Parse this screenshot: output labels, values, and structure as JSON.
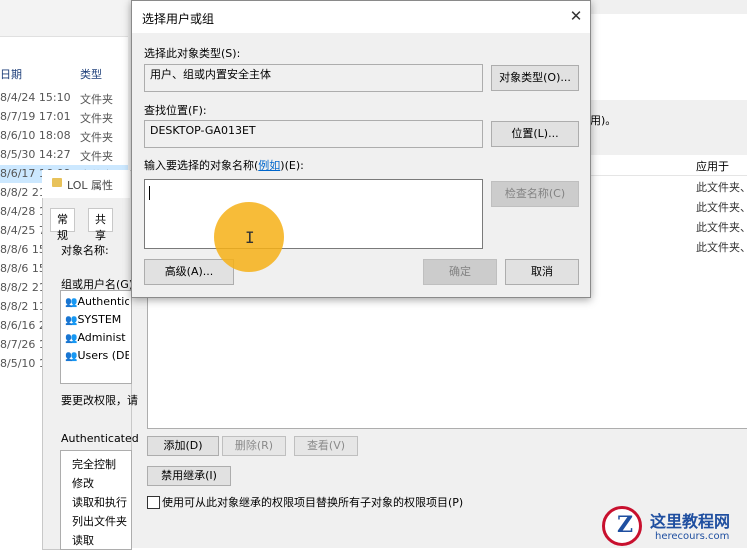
{
  "explorer": {
    "col_date": "日期",
    "col_type": "类型",
    "rows": [
      {
        "date": "8/4/24 15:10",
        "type": "文件夹"
      },
      {
        "date": "8/7/19 17:01",
        "type": "文件夹"
      },
      {
        "date": "8/6/10 18:08",
        "type": "文件夹"
      },
      {
        "date": "8/5/30 14:27",
        "type": "文件夹"
      },
      {
        "date": "8/6/17 16:09",
        "type": "文件夹"
      },
      {
        "date": "8/8/2 21:",
        "type": ""
      },
      {
        "date": "8/4/28 1",
        "type": ""
      },
      {
        "date": "8/4/25 7:",
        "type": ""
      },
      {
        "date": "8/8/6 15:",
        "type": ""
      },
      {
        "date": "8/8/6 15:",
        "type": ""
      },
      {
        "date": "8/8/2 21:",
        "type": ""
      },
      {
        "date": "8/8/2 11:",
        "type": ""
      },
      {
        "date": "8/6/16 20",
        "type": ""
      },
      {
        "date": "8/7/26 10",
        "type": ""
      },
      {
        "date": "8/5/10 15",
        "type": ""
      }
    ]
  },
  "properties": {
    "title": "LOL 属性",
    "tabs": [
      "常规",
      "共享"
    ],
    "object_name_label": "对象名称:",
    "group_label": "组或用户名(G):",
    "users": [
      "Authentic",
      "SYSTEM",
      "Administ",
      "Users (DE"
    ],
    "change_perm_text": "要更改权限，请",
    "perm_for": "Authenticated",
    "permissions": [
      "完全控制",
      "修改",
      "读取和执行",
      "列出文件夹",
      "读取"
    ]
  },
  "advanced": {
    "header_fragment": "用)。",
    "col_applies": "应用于",
    "applies_rows": [
      "此文件夹、",
      "此文件夹、",
      "此文件夹、",
      "此文件夹、"
    ],
    "btn_add": "添加(D)",
    "btn_remove": "删除(R)",
    "btn_view": "查看(V)",
    "btn_disable_inherit": "禁用继承(I)",
    "replace_checkbox": "使用可从此对象继承的权限项目替换所有子对象的权限项目(P)"
  },
  "dialog": {
    "title": "选择用户或组",
    "close_glyph": "✕",
    "object_type_label": "选择此对象类型(S):",
    "object_type_value": "用户、组或内置安全主体",
    "object_type_button": "对象类型(O)...",
    "location_label": "查找位置(F):",
    "location_value": "DESKTOP-GA013ET",
    "location_button": "位置(L)...",
    "enter_names_prefix": "输入要选择的对象名称(",
    "enter_names_link": "例如",
    "enter_names_suffix": ")(E):",
    "enter_names_value": "",
    "check_names_button": "检查名称(C)",
    "advanced_button": "高级(A)...",
    "ok_button": "确定",
    "cancel_button": "取消"
  },
  "watermark": {
    "letter": "Z",
    "title": "这里教程网",
    "url": "herecours.com"
  },
  "colors": {
    "accent_link": "#0066cc",
    "cursor_halo": "#f6b016",
    "watermark_blue": "#1f4fa0",
    "watermark_red": "#c8102e"
  }
}
